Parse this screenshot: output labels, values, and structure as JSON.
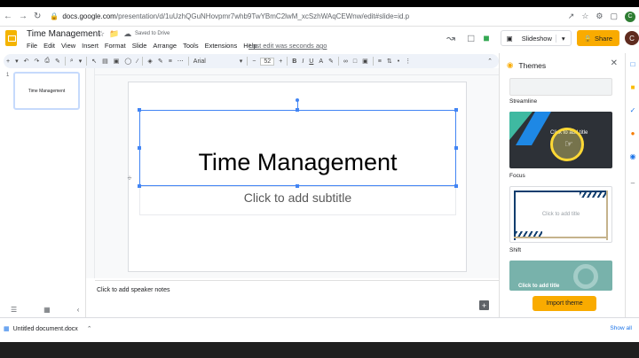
{
  "browser": {
    "url_host": "docs.google.com",
    "url_path": "/presentation/d/1uUzhQGuNHovpmr7whb9TwYBmC2lwM_xcSzhWAqCEWnw/edit#slide=id.p"
  },
  "app": {
    "doc_title": "Time Management",
    "saved_status": "Saved to Drive",
    "menus": [
      "File",
      "Edit",
      "View",
      "Insert",
      "Format",
      "Slide",
      "Arrange",
      "Tools",
      "Extensions",
      "Help"
    ],
    "last_edit": "Last edit was seconds ago",
    "slideshow_label": "Slideshow",
    "share_label": "Share",
    "avatar_letter": "C",
    "brand_color": "#f4b400",
    "accent_color": "#4285f4"
  },
  "toolbar": {
    "font": "Arial",
    "font_size": "52"
  },
  "filmstrip": {
    "slide_number": "1",
    "thumb_title": "Time Management"
  },
  "slide": {
    "title": "Time Management",
    "subtitle": "Click to add subtitle"
  },
  "notes": {
    "placeholder": "Click to add speaker notes"
  },
  "themes_panel": {
    "title": "Themes",
    "themes": [
      {
        "name": "Streamline",
        "preview_text": ""
      },
      {
        "name": "Focus",
        "preview_text": "Click to add title"
      },
      {
        "name": "Shift",
        "preview_text": "Click to add title"
      },
      {
        "name": "",
        "preview_text": "Click to add title"
      }
    ],
    "import_label": "Import theme"
  },
  "downloads": {
    "file": "Untitled document.docx",
    "show_all": "Show all"
  }
}
